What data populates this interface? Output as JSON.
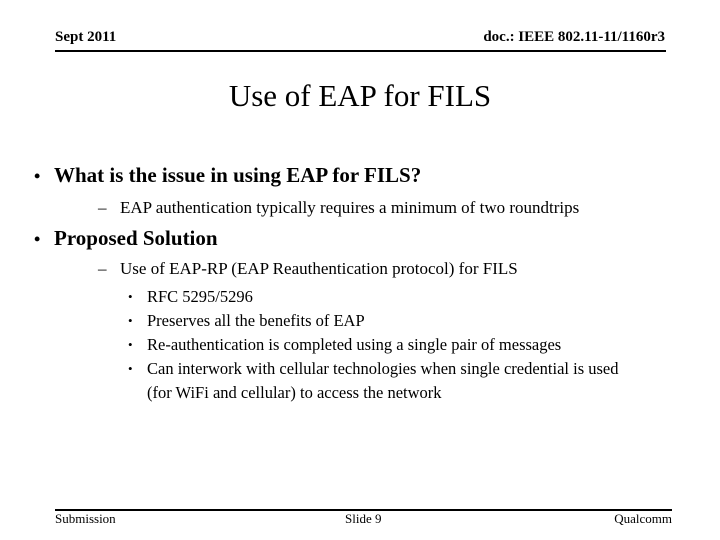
{
  "header": {
    "date": "Sept 2011",
    "doc_id": "doc.: IEEE 802.11-11/1160r3"
  },
  "slide": {
    "title": "Use of EAP for FILS",
    "bullets": [
      {
        "text": "What is the issue in using EAP for FILS?",
        "sub": [
          {
            "text": "EAP authentication typically requires a minimum of two roundtrips"
          }
        ]
      },
      {
        "text": "Proposed Solution",
        "sub": [
          {
            "text": "Use of EAP-RP (EAP Reauthentication protocol) for FILS",
            "sub": [
              "RFC 5295/5296",
              "Preserves all the benefits of EAP",
              "Re-authentication is completed using a single pair of messages",
              "Can interwork with cellular technologies when single credential is used (for WiFi and cellular) to access the network"
            ]
          }
        ]
      }
    ],
    "bullet_glyph": "•",
    "dash_glyph": "–"
  },
  "footer": {
    "left": "Submission",
    "center": "Slide 9",
    "right": "Qualcomm"
  }
}
